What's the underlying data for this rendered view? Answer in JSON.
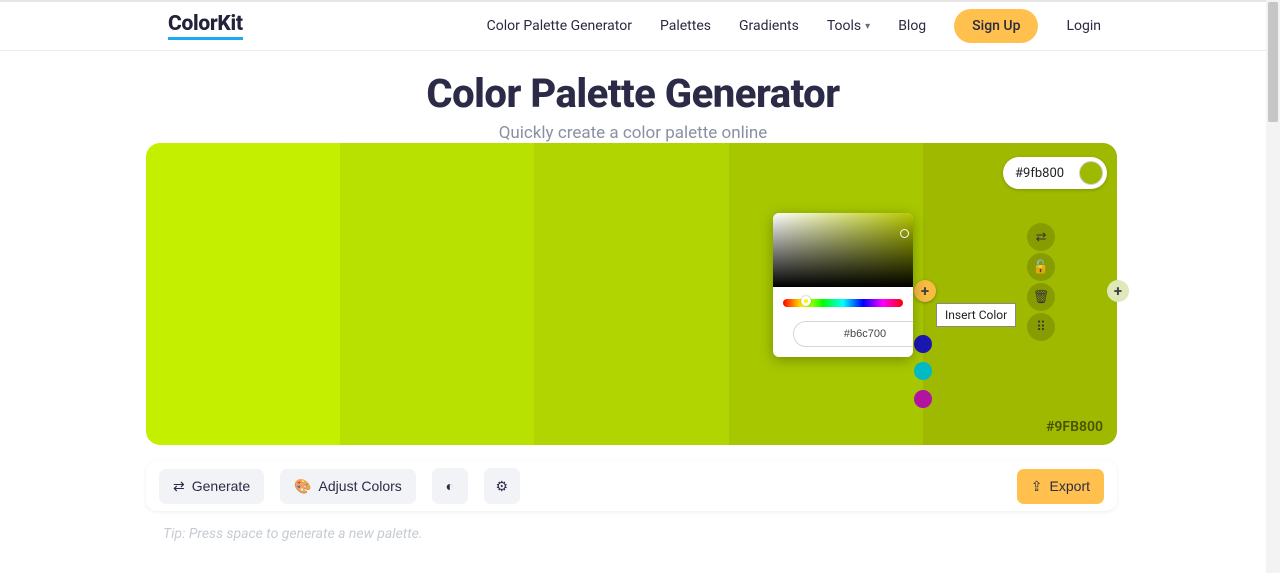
{
  "brand": "ColorKit",
  "nav": {
    "generator": "Color Palette Generator",
    "palettes": "Palettes",
    "gradients": "Gradients",
    "tools": "Tools",
    "blog": "Blog",
    "signup": "Sign Up",
    "login": "Login"
  },
  "title": "Color Palette Generator",
  "subtitle": "Quickly create a color palette online",
  "palette": {
    "swatches": [
      {
        "hex": "#c4f000"
      },
      {
        "hex": "#b8e000"
      },
      {
        "hex": "#b0d500"
      },
      {
        "hex": "#a7c800"
      },
      {
        "hex": "#9fb800"
      }
    ],
    "active_swatch_label": "#9FB800"
  },
  "swatch_controls": {
    "hex_display": "#9fb800",
    "hex_dot_color": "#9fb800"
  },
  "picker": {
    "hex_input": "#b6c700",
    "dot_color": "#9fb800"
  },
  "presets": [
    {
      "color": "#1b17b3"
    },
    {
      "color": "#00bac5"
    },
    {
      "color": "#b213a1"
    }
  ],
  "tooltip": "Insert Color",
  "toolbar": {
    "generate": "Generate",
    "adjust": "Adjust Colors",
    "export": "Export"
  },
  "tip": "Tip: Press space to generate a new palette."
}
